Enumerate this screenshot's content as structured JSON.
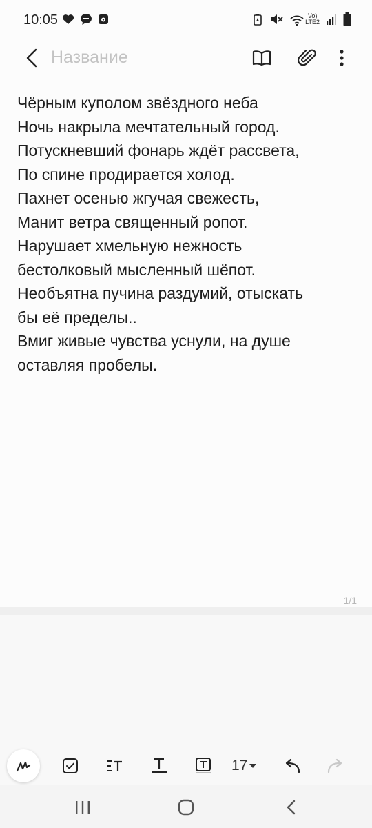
{
  "status_bar": {
    "time": "10:05",
    "left_icons": [
      "heart-icon",
      "chat-bubble-icon",
      "music-app-icon"
    ],
    "right_icons": [
      "battery-saver-icon",
      "mute-icon",
      "wifi-icon",
      "signal-icon",
      "battery-icon"
    ],
    "network_label_top": "Vo)",
    "network_label_bottom": "LTE2"
  },
  "toolbar": {
    "title_placeholder": "Название",
    "title_value": "",
    "back_icon": "back-chevron-icon",
    "reader_icon": "book-icon",
    "attach_icon": "paperclip-icon",
    "more_icon": "more-vertical-icon"
  },
  "note": {
    "lines": [
      "Чёрным куполом звёздного неба",
      "Ночь накрыла мечтательный город.",
      "Потускневший фонарь ждёт рассвета,",
      "По спине продирается холод.",
      "Пахнет осенью жгучая свежесть,",
      "Манит ветра священный ропот.",
      "Нарушает хмельную нежность",
      "бестолковый мысленный шёпот.",
      "Необъятна пучина раздумий, отыскать",
      "бы её пределы..",
      "Вмиг живые чувства уснули, на душе",
      "оставляя пробелы."
    ]
  },
  "page_indicator": "1/1",
  "format_bar": {
    "font_size": "17",
    "tools": [
      "pen-icon",
      "checkbox-icon",
      "text-style-icon",
      "underline-text-icon",
      "text-box-icon",
      "font-size-dropdown",
      "undo-icon",
      "redo-icon"
    ]
  },
  "nav_bar": {
    "buttons": [
      "recent-apps-icon",
      "home-icon",
      "back-icon"
    ]
  },
  "colors": {
    "background": "#fcfcfc",
    "text": "#1e1e1e",
    "placeholder": "#c3c3c3",
    "disabled_icon": "#c8c8c8"
  }
}
